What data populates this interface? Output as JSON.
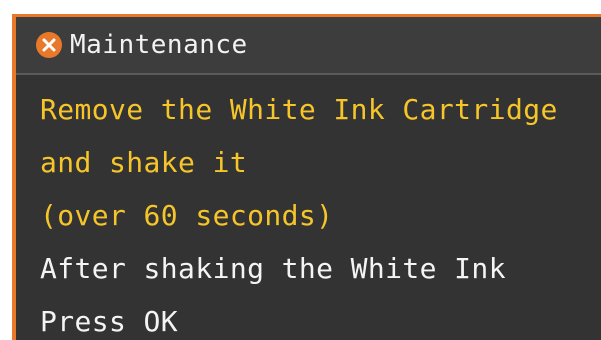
{
  "dialog": {
    "title": "Maintenance",
    "title_icon": "error-icon",
    "lines": [
      {
        "text": "Remove the White Ink Cartridge",
        "color": "#f6c52a"
      },
      {
        "text": "and shake it",
        "color": "#f6c52a"
      },
      {
        "text": "(over 60 seconds)",
        "color": "#f6c52a"
      },
      {
        "text": "After shaking the White Ink",
        "color": "#f4f4f4"
      },
      {
        "text": "Press OK",
        "color": "#f4f4f4"
      }
    ]
  },
  "colors": {
    "accent": "#e8792b",
    "background": "#333333",
    "highlight_text": "#f6c52a",
    "normal_text": "#f4f4f4"
  }
}
